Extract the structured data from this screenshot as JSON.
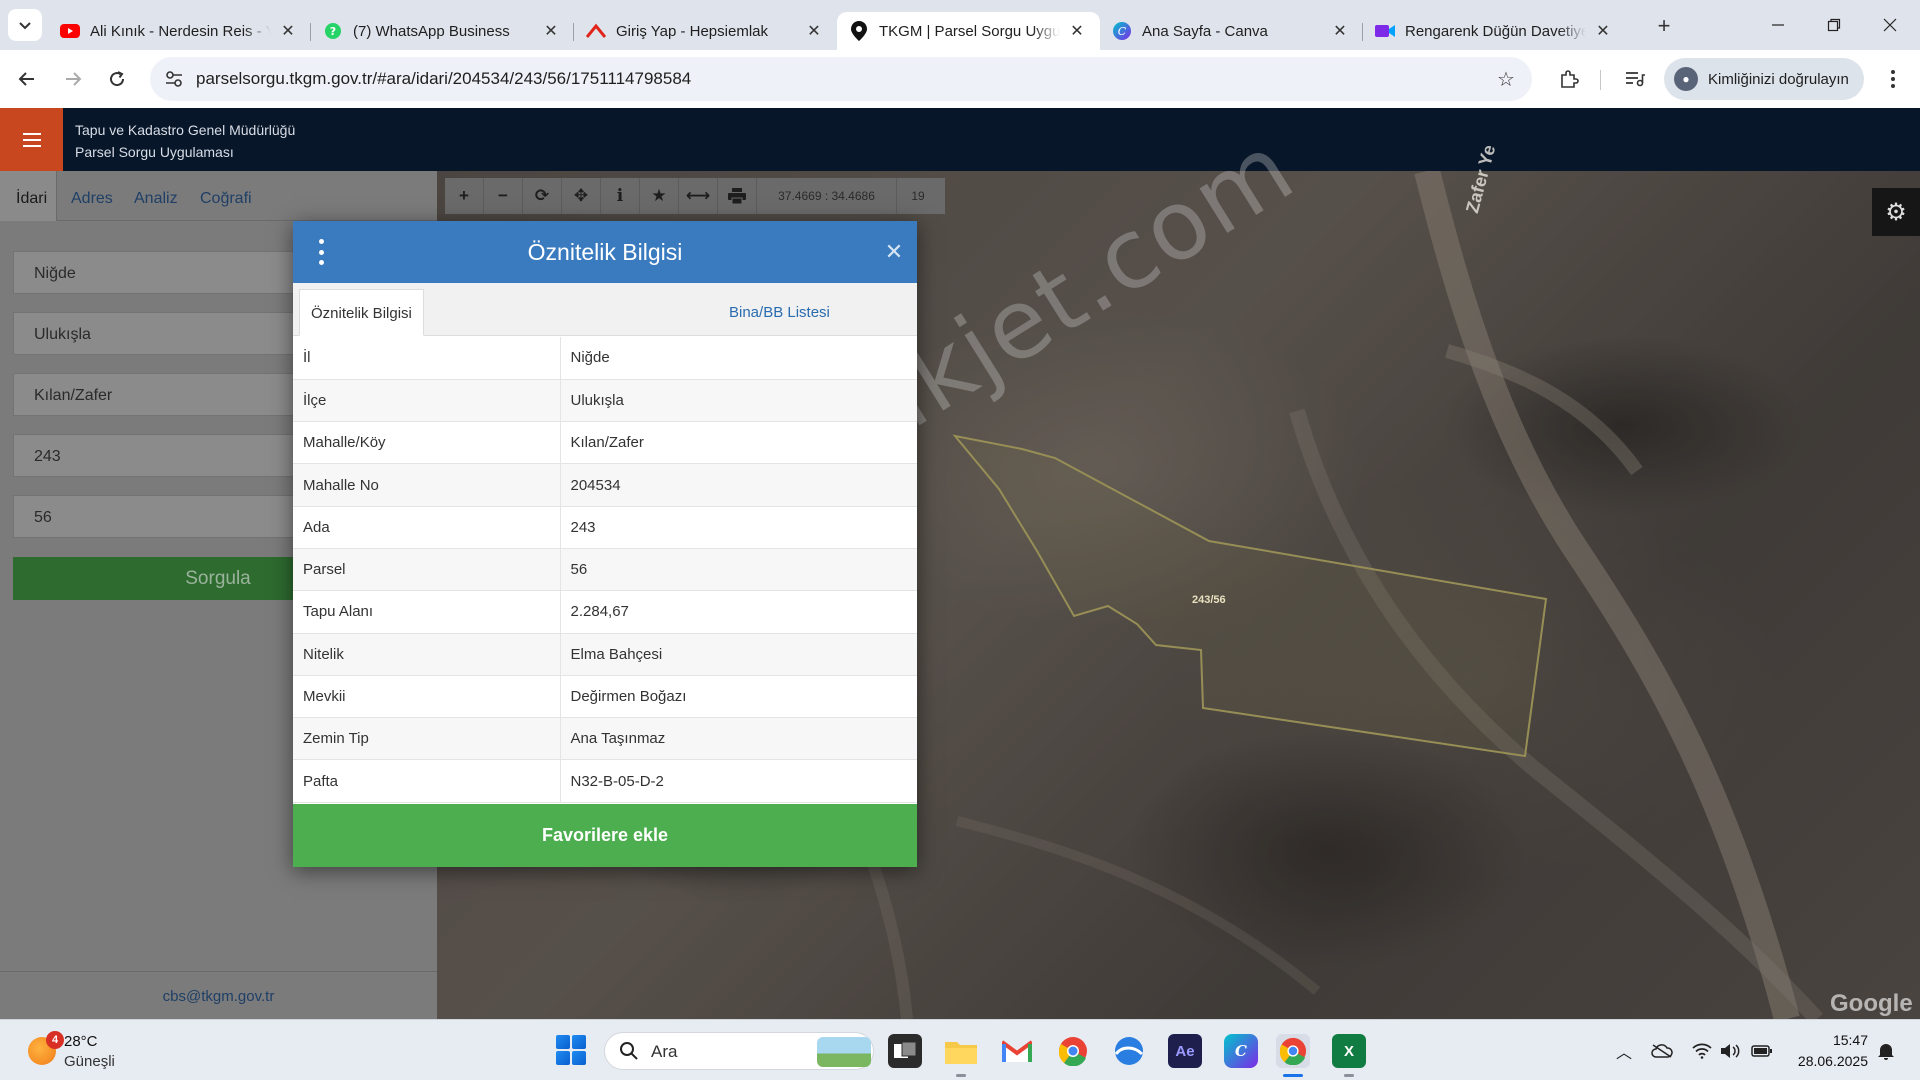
{
  "browser": {
    "tabs": [
      {
        "title": "Ali Kınık - Nerdesin Reis - Y",
        "favicon": "youtube-icon",
        "active": false
      },
      {
        "title": "(7) WhatsApp Business",
        "favicon": "whatsapp-icon",
        "active": false
      },
      {
        "title": "Giriş Yap - Hepsiemlak",
        "favicon": "hepsiemlak-icon",
        "active": false
      },
      {
        "title": "TKGM | Parsel Sorgu Uygulama",
        "favicon": "map-pin-icon",
        "active": true
      },
      {
        "title": "Ana Sayfa - Canva",
        "favicon": "canva-icon",
        "active": false
      },
      {
        "title": "Rengarenk Düğün Davetiye",
        "favicon": "canva-video-icon",
        "active": false
      }
    ],
    "url": "parselsorgu.tkgm.gov.tr/#ara/idari/204534/243/56/1751114798584",
    "profile_label": "Kimliğinizi doğrulayın"
  },
  "app": {
    "title_line1": "Tapu ve Kadastro Genel Müdürlüğü",
    "title_line2": "Parsel Sorgu Uygulaması"
  },
  "left_panel": {
    "tabs": [
      "İdari",
      "Adres",
      "Analiz",
      "Coğrafi"
    ],
    "fields": [
      "Niğde",
      "Ulukışla",
      "Kılan/Zafer",
      "243",
      "56"
    ],
    "search_button": "Sorgula",
    "footer_email": "cbs@tkgm.gov.tr"
  },
  "map": {
    "coordinates": "37.4669 : 34.4686",
    "zoom": "19",
    "parcel_label": "243/56",
    "road_label": "Zafer Ye",
    "watermark": "emlakjet.com",
    "provider": "Google"
  },
  "modal": {
    "title": "Öznitelik Bilgisi",
    "tabs": [
      "Öznitelik Bilgisi",
      "Bina/BB Listesi"
    ],
    "rows": [
      {
        "key": "İl",
        "value": "Niğde"
      },
      {
        "key": "İlçe",
        "value": "Ulukışla"
      },
      {
        "key": "Mahalle/Köy",
        "value": "Kılan/Zafer"
      },
      {
        "key": "Mahalle No",
        "value": "204534"
      },
      {
        "key": "Ada",
        "value": "243"
      },
      {
        "key": "Parsel",
        "value": "56"
      },
      {
        "key": "Tapu Alanı",
        "value": "2.284,67"
      },
      {
        "key": "Nitelik",
        "value": "Elma Bahçesi"
      },
      {
        "key": "Mevkii",
        "value": "Değirmen Boğazı"
      },
      {
        "key": "Zemin Tip",
        "value": "Ana Taşınmaz"
      },
      {
        "key": "Pafta",
        "value": "N32-B-05-D-2"
      }
    ],
    "favorite_button": "Favorilere ekle"
  },
  "taskbar": {
    "weather_temp": "28°C",
    "weather_desc": "Güneşli",
    "weather_badge": "4",
    "search_label": "Ara",
    "time": "15:47",
    "date": "28.06.2025"
  }
}
